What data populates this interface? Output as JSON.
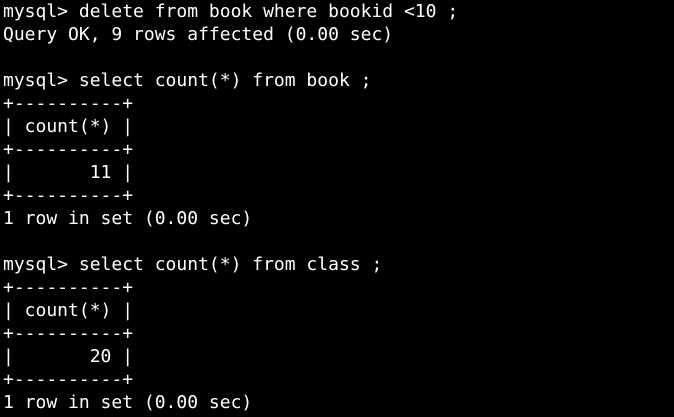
{
  "terminal": {
    "lines": [
      "mysql> delete from book where bookid <10 ;",
      "Query OK, 9 rows affected (0.00 sec)",
      "",
      "mysql> select count(*) from book ;",
      "+----------+",
      "| count(*) |",
      "+----------+",
      "|       11 |",
      "+----------+",
      "1 row in set (0.00 sec)",
      "",
      "mysql> select count(*) from class ;",
      "+----------+",
      "| count(*) |",
      "+----------+",
      "|       20 |",
      "+----------+",
      "1 row in set (0.00 sec)"
    ]
  },
  "colors": {
    "background": "#000000",
    "text": "#ffffff"
  }
}
